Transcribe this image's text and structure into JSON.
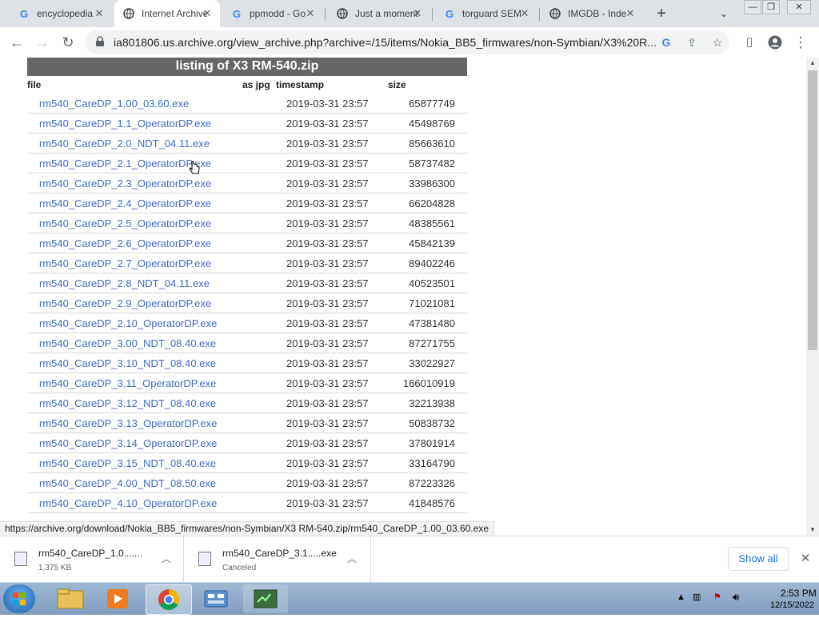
{
  "browser": {
    "tabs": [
      {
        "title": "encyclopedia",
        "favicon": "google-icon",
        "active": false
      },
      {
        "title": "Internet Archive",
        "favicon": "globe-icon",
        "active": true
      },
      {
        "title": "ppmodd - Go",
        "favicon": "google-icon",
        "active": false
      },
      {
        "title": "Just a moment",
        "favicon": "globe-icon",
        "active": false
      },
      {
        "title": "torguard SEM",
        "favicon": "google-icon",
        "active": false
      },
      {
        "title": "IMGDB - Inde",
        "favicon": "globe-icon",
        "active": false
      }
    ],
    "url": "ia801806.us.archive.org/view_archive.php?archive=/15/items/Nokia_BB5_firmwares/non-Symbian/X3%20R..."
  },
  "listing": {
    "title": "listing of X3 RM-540.zip",
    "headers": {
      "file": "file",
      "jpg": "as jpg",
      "timestamp": "timestamp",
      "size": "size"
    },
    "rows": [
      {
        "file": "rm540_CareDP_1.00_03.60.exe",
        "timestamp": "2019-03-31 23:57",
        "size": "65877749"
      },
      {
        "file": "rm540_CareDP_1.1_OperatorDP.exe",
        "timestamp": "2019-03-31 23:57",
        "size": "45498769"
      },
      {
        "file": "rm540_CareDP_2.0_NDT_04.11.exe",
        "timestamp": "2019-03-31 23:57",
        "size": "85663610"
      },
      {
        "file": "rm540_CareDP_2.1_OperatorDP.exe",
        "timestamp": "2019-03-31 23:57",
        "size": "58737482"
      },
      {
        "file": "rm540_CareDP_2.3_OperatorDP.exe",
        "timestamp": "2019-03-31 23:57",
        "size": "33986300"
      },
      {
        "file": "rm540_CareDP_2.4_OperatorDP.exe",
        "timestamp": "2019-03-31 23:57",
        "size": "66204828"
      },
      {
        "file": "rm540_CareDP_2.5_OperatorDP.exe",
        "timestamp": "2019-03-31 23:57",
        "size": "48385561"
      },
      {
        "file": "rm540_CareDP_2.6_OperatorDP.exe",
        "timestamp": "2019-03-31 23:57",
        "size": "45842139"
      },
      {
        "file": "rm540_CareDP_2.7_OperatorDP.exe",
        "timestamp": "2019-03-31 23:57",
        "size": "89402246"
      },
      {
        "file": "rm540_CareDP_2.8_NDT_04.11.exe",
        "timestamp": "2019-03-31 23:57",
        "size": "40523501"
      },
      {
        "file": "rm540_CareDP_2.9_OperatorDP.exe",
        "timestamp": "2019-03-31 23:57",
        "size": "71021081"
      },
      {
        "file": "rm540_CareDP_2.10_OperatorDP.exe",
        "timestamp": "2019-03-31 23:57",
        "size": "47381480"
      },
      {
        "file": "rm540_CareDP_3.00_NDT_08.40.exe",
        "timestamp": "2019-03-31 23:57",
        "size": "87271755"
      },
      {
        "file": "rm540_CareDP_3.10_NDT_08.40.exe",
        "timestamp": "2019-03-31 23:57",
        "size": "33022927"
      },
      {
        "file": "rm540_CareDP_3.11_OperatorDP.exe",
        "timestamp": "2019-03-31 23:57",
        "size": "166010919"
      },
      {
        "file": "rm540_CareDP_3.12_NDT_08.40.exe",
        "timestamp": "2019-03-31 23:57",
        "size": "32213938"
      },
      {
        "file": "rm540_CareDP_3.13_OperatorDP.exe",
        "timestamp": "2019-03-31 23:57",
        "size": "50838732"
      },
      {
        "file": "rm540_CareDP_3.14_OperatorDP.exe",
        "timestamp": "2019-03-31 23:57",
        "size": "37801914"
      },
      {
        "file": "rm540_CareDP_3.15_NDT_08.40.exe",
        "timestamp": "2019-03-31 23:57",
        "size": "33164790"
      },
      {
        "file": "rm540_CareDP_4.00_NDT_08.50.exe",
        "timestamp": "2019-03-31 23:57",
        "size": "87223326"
      },
      {
        "file": "rm540_CareDP_4.10_OperatorDP.exe",
        "timestamp": "2019-03-31 23:57",
        "size": "41848576"
      }
    ]
  },
  "status_url": "https://archive.org/download/Nokia_BB5_firmwares/non-Symbian/X3 RM-540.zip/rm540_CareDP_1.00_03.60.exe",
  "downloads": {
    "items": [
      {
        "name": "rm540_CareDP_1.0.......",
        "status": "1,375 KB"
      },
      {
        "name": "rm540_CareDP_3.1.....exe",
        "status": "Canceled"
      }
    ],
    "show_all": "Show all"
  },
  "taskbar": {
    "time": "2:53 PM",
    "date": "12/15/2022"
  }
}
